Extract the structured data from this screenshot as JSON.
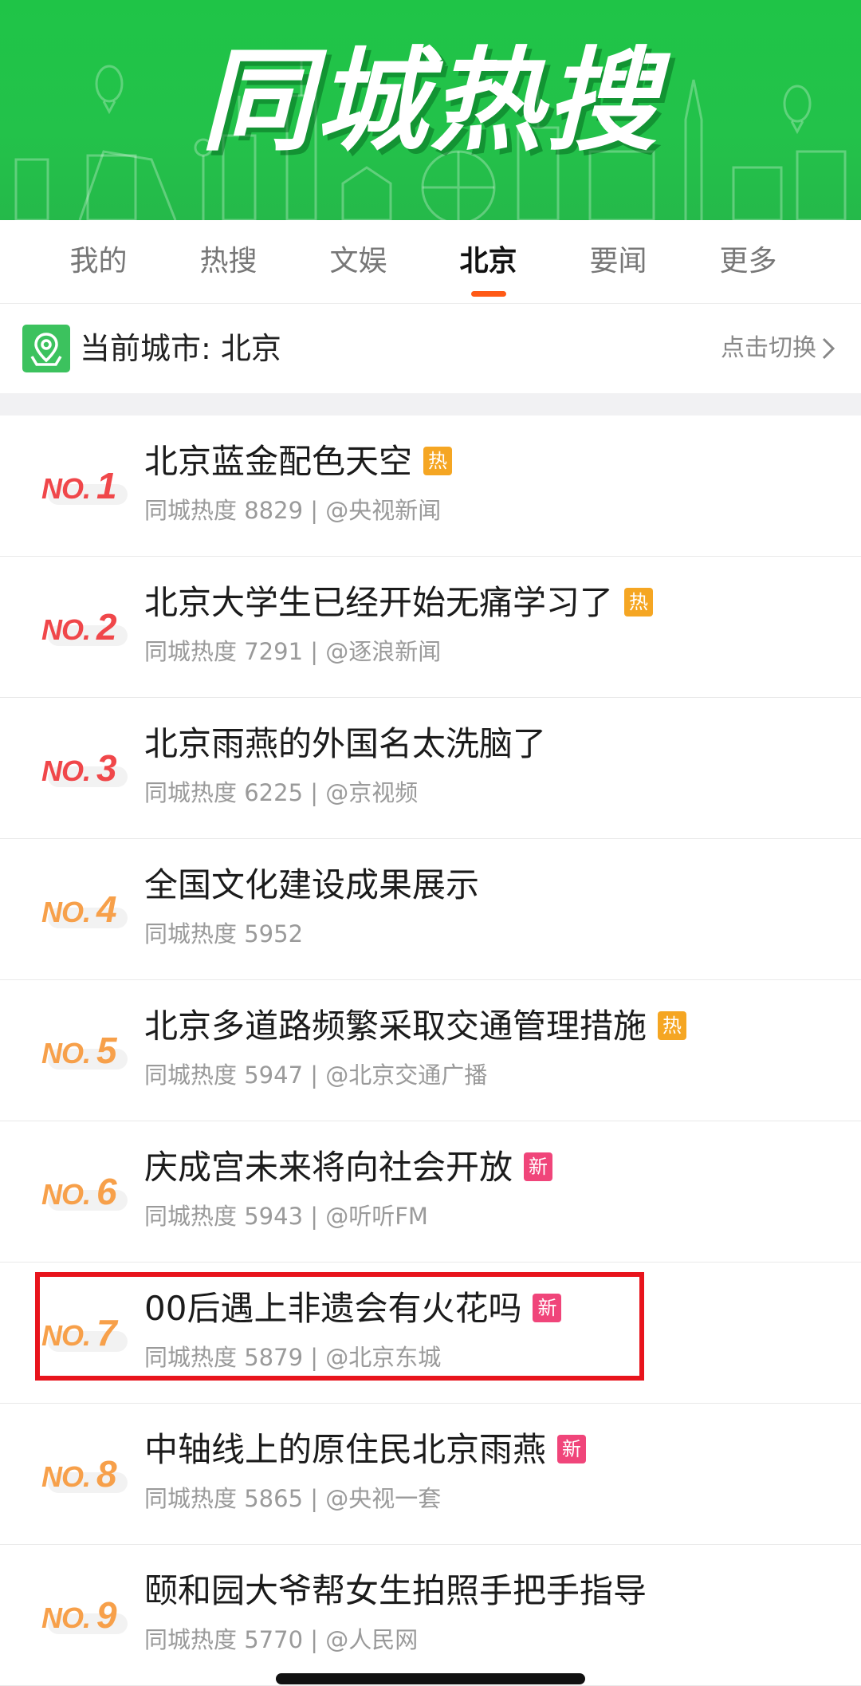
{
  "banner": {
    "title": "同城热搜"
  },
  "tabs": [
    {
      "label": "我的",
      "active": false
    },
    {
      "label": "热搜",
      "active": false
    },
    {
      "label": "文娱",
      "active": false
    },
    {
      "label": "北京",
      "active": true
    },
    {
      "label": "要闻",
      "active": false
    },
    {
      "label": "更多",
      "active": false
    }
  ],
  "city": {
    "label": "当前城市: 北京",
    "switch_label": "点击切换"
  },
  "list": [
    {
      "rank_prefix": "NO.",
      "rank": "1",
      "title": "北京蓝金配色天空",
      "badge": "热",
      "meta": "同城热度 8829 | @央视新闻",
      "rank_color": "#f0474a"
    },
    {
      "rank_prefix": "NO.",
      "rank": "2",
      "title": "北京大学生已经开始无痛学习了",
      "badge": "热",
      "meta": "同城热度 7291 | @逐浪新闻",
      "rank_color": "#f0474a"
    },
    {
      "rank_prefix": "NO.",
      "rank": "3",
      "title": "北京雨燕的外国名太洗脑了",
      "badge": "",
      "meta": "同城热度 6225 | @京视频",
      "rank_color": "#f0474a"
    },
    {
      "rank_prefix": "NO.",
      "rank": "4",
      "title": "全国文化建设成果展示",
      "badge": "",
      "meta": "同城热度 5952",
      "rank_color": "#f7a04a"
    },
    {
      "rank_prefix": "NO.",
      "rank": "5",
      "title": "北京多道路频繁采取交通管理措施",
      "badge": "热",
      "meta": "同城热度 5947 | @北京交通广播",
      "rank_color": "#f7a04a"
    },
    {
      "rank_prefix": "NO.",
      "rank": "6",
      "title": "庆成宫未来将向社会开放",
      "badge": "新",
      "meta": "同城热度 5943 | @听听FM",
      "rank_color": "#f7a04a"
    },
    {
      "rank_prefix": "NO.",
      "rank": "7",
      "title": "00后遇上非遗会有火花吗",
      "badge": "新",
      "meta": "同城热度 5879 | @北京东城",
      "rank_color": "#f7a04a"
    },
    {
      "rank_prefix": "NO.",
      "rank": "8",
      "title": "中轴线上的原住民北京雨燕",
      "badge": "新",
      "meta": "同城热度 5865 | @央视一套",
      "rank_color": "#f7a04a"
    },
    {
      "rank_prefix": "NO.",
      "rank": "9",
      "title": "颐和园大爷帮女生拍照手把手指导",
      "badge": "",
      "meta": "同城热度 5770 | @人民网",
      "rank_color": "#f7a04a"
    }
  ],
  "colors": {
    "banner_green": "#23c24a",
    "tab_indicator": "#ff5a16",
    "badge_hot": "#f5a623",
    "badge_new": "#f0457a",
    "highlight_border": "#e8141c"
  }
}
